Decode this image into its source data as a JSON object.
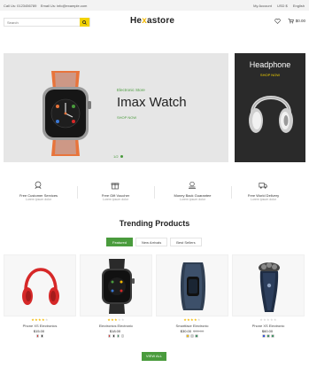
{
  "topbar": {
    "call": "Call Us: 0123456789",
    "email": "Email Us: info@example.com",
    "myaccount": "My Account",
    "currency": "USD $",
    "language": "English"
  },
  "header": {
    "search_placeholder": "Search",
    "logo_main": "He",
    "logo_accent": "x",
    "logo_rest": "astore",
    "cart_total": "$0.00"
  },
  "hero": {
    "tag": "Electronic Store",
    "title": "Imax Watch",
    "shop": "SHOP NOW",
    "slide": "1/2"
  },
  "promo": {
    "title": "Headphone",
    "shop": "SHOP NOW"
  },
  "features": [
    {
      "title": "Free Customer Services",
      "sub": "Lorem ipsum dolor",
      "icon": "support-icon"
    },
    {
      "title": "Free Gift Voucher",
      "sub": "Lorem ipsum dolor",
      "icon": "gift-icon"
    },
    {
      "title": "Money Back Guarantee",
      "sub": "Lorem ipsum dolor",
      "icon": "money-back-icon"
    },
    {
      "title": "Free World Delivery",
      "sub": "Lorem ipsum dolor",
      "icon": "truck-icon"
    }
  ],
  "trending": {
    "title": "Trending Products",
    "tabs": [
      "Featured",
      "New Arrivals",
      "Best Sellers"
    ],
    "view_all": "VIEW ALL"
  },
  "products": [
    {
      "name": "Phone XS Electronics",
      "price": "$15.00",
      "old_price": "",
      "rating": 4,
      "swatches": [
        "#d62828",
        "#222222"
      ]
    },
    {
      "name": "Electronics Electronic",
      "price": "$18.00",
      "old_price": "",
      "rating": 3,
      "swatches": [
        "#d62828",
        "#222222",
        "#2e8b57",
        "#dddddd"
      ]
    },
    {
      "name": "Smartface Electronic",
      "price": "$30.00",
      "old_price": "$35.00",
      "rating": 4,
      "swatches": [
        "#f2b800",
        "#cccccc",
        "#2e8b57"
      ]
    },
    {
      "name": "Phone XS Electronic",
      "price": "$60.00",
      "old_price": "",
      "rating": 0,
      "swatches": [
        "#1e3fd8",
        "#2e8b57",
        "#2e8b57"
      ]
    }
  ],
  "colors": {
    "accent": "#4a9b3d",
    "brand_yellow": "#f2b800",
    "star": "#f2b800"
  }
}
